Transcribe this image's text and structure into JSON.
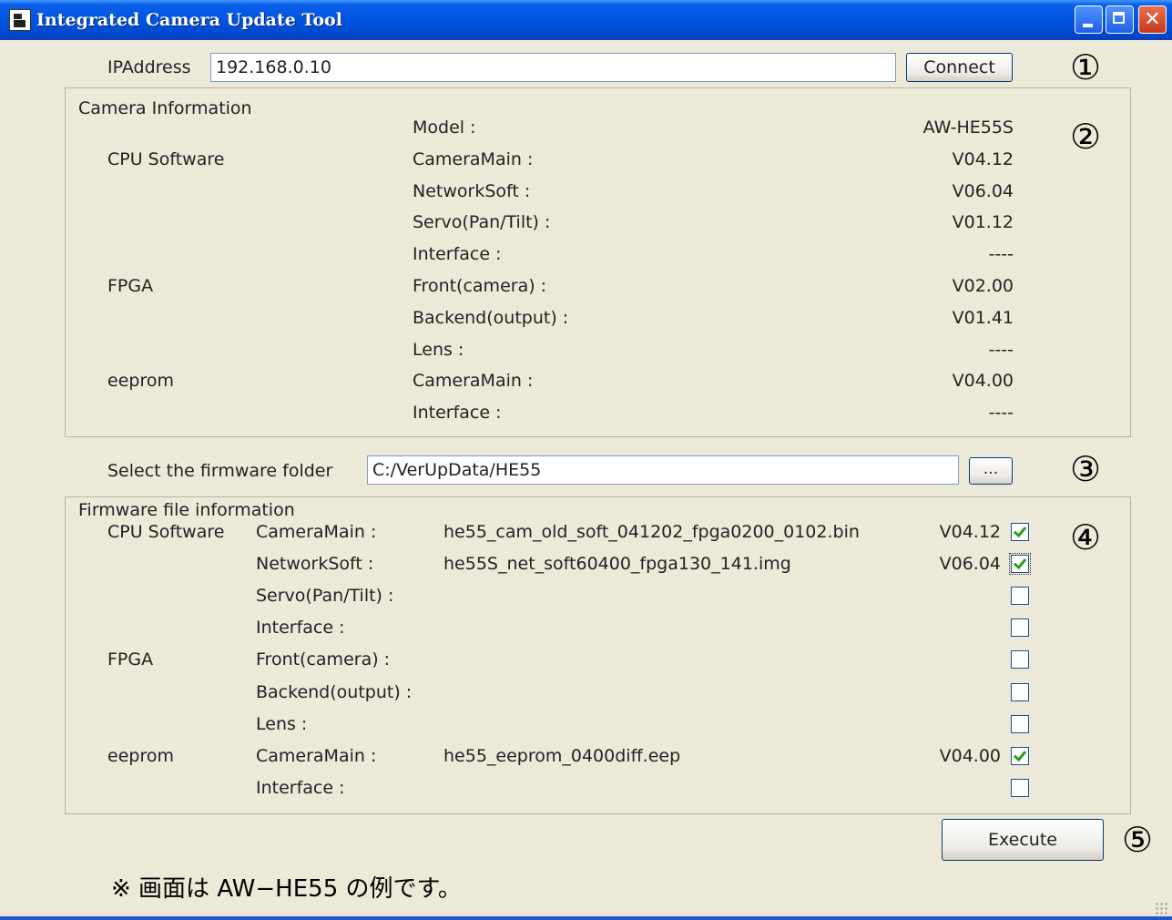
{
  "window": {
    "title": "Integrated Camera Update Tool"
  },
  "connection": {
    "ip_label": "IPAddress",
    "ip_value": "192.168.0.10",
    "connect_label": "Connect"
  },
  "markers": [
    "①",
    "②",
    "③",
    "④",
    "⑤"
  ],
  "camera_info": {
    "title": "Camera  Information",
    "rows": [
      {
        "group": "",
        "label": "Model :",
        "value": "AW-HE55S"
      },
      {
        "group": "CPU Software",
        "label": "CameraMain :",
        "value": "V04.12"
      },
      {
        "group": "",
        "label": "NetworkSoft :",
        "value": "V06.04"
      },
      {
        "group": "",
        "label": "Servo(Pan/Tilt) :",
        "value": "V01.12"
      },
      {
        "group": "",
        "label": "Interface :",
        "value": "----"
      },
      {
        "group": "FPGA",
        "label": "Front(camera) :",
        "value": "V02.00"
      },
      {
        "group": "",
        "label": "Backend(output) :",
        "value": "V01.41"
      },
      {
        "group": "",
        "label": "Lens :",
        "value": "----"
      },
      {
        "group": "eeprom",
        "label": "CameraMain :",
        "value": "V04.00"
      },
      {
        "group": "",
        "label": "Interface :",
        "value": "----"
      }
    ]
  },
  "folder": {
    "label": "Select the firmware folder",
    "value": "C:/VerUpData/HE55",
    "browse_label": "..."
  },
  "firmware_info": {
    "title": "Firmware file information",
    "rows": [
      {
        "group": "CPU Software",
        "label": "CameraMain :",
        "file": "he55_cam_old_soft_041202_fpga0200_0102.bin",
        "version": "V04.12",
        "checked": true
      },
      {
        "group": "",
        "label": "NetworkSoft :",
        "file": "he55S_net_soft60400_fpga130_141.img",
        "version": "V06.04",
        "checked": true
      },
      {
        "group": "",
        "label": "Servo(Pan/Tilt) :",
        "file": "",
        "version": "",
        "checked": false
      },
      {
        "group": "",
        "label": "Interface :",
        "file": "",
        "version": "",
        "checked": false
      },
      {
        "group": "FPGA",
        "label": "Front(camera) :",
        "file": "",
        "version": "",
        "checked": false
      },
      {
        "group": "",
        "label": "Backend(output) :",
        "file": "",
        "version": "",
        "checked": false
      },
      {
        "group": "",
        "label": "Lens :",
        "file": "",
        "version": "",
        "checked": false
      },
      {
        "group": "eeprom",
        "label": "CameraMain :",
        "file": "he55_eeprom_0400diff.eep",
        "version": "V04.00",
        "checked": true
      },
      {
        "group": "",
        "label": "Interface :",
        "file": "",
        "version": "",
        "checked": false
      }
    ]
  },
  "execute_label": "Execute",
  "note": "※ 画面は AW−HE55 の例です。"
}
